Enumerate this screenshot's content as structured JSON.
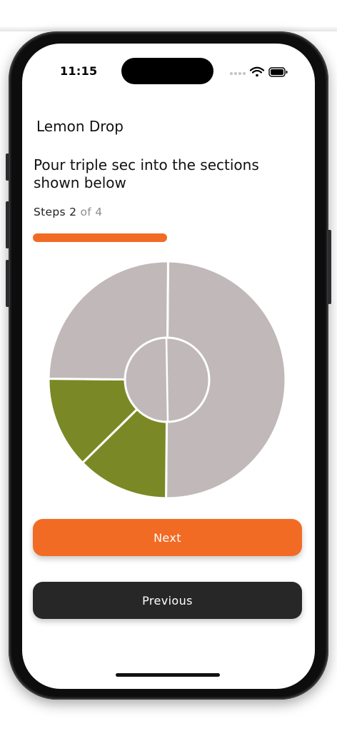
{
  "status_bar": {
    "time": "11:15"
  },
  "header": {
    "title": "Lemon Drop"
  },
  "instruction": "Pour triple sec into the sections shown below",
  "steps": {
    "label": "Steps",
    "current": "2",
    "of_text": "of 4",
    "progress": 0.5
  },
  "colors": {
    "accent": "#f26b25",
    "highlight": "#7a8925",
    "inactive": "#c0b8b9",
    "dark_button": "#272727"
  },
  "chart_data": {
    "type": "pie",
    "categories": [
      "right-half",
      "bottom-left-upper",
      "bottom-left-lower",
      "top-left",
      "center"
    ],
    "values": [
      50,
      12.5,
      12.5,
      25,
      100
    ],
    "highlighted": [
      false,
      true,
      true,
      false,
      false
    ]
  },
  "buttons": {
    "next_label": "Next",
    "previous_label": "Previous"
  },
  "icons": [
    "signal-dots-icon",
    "wifi-icon",
    "battery-icon"
  ]
}
